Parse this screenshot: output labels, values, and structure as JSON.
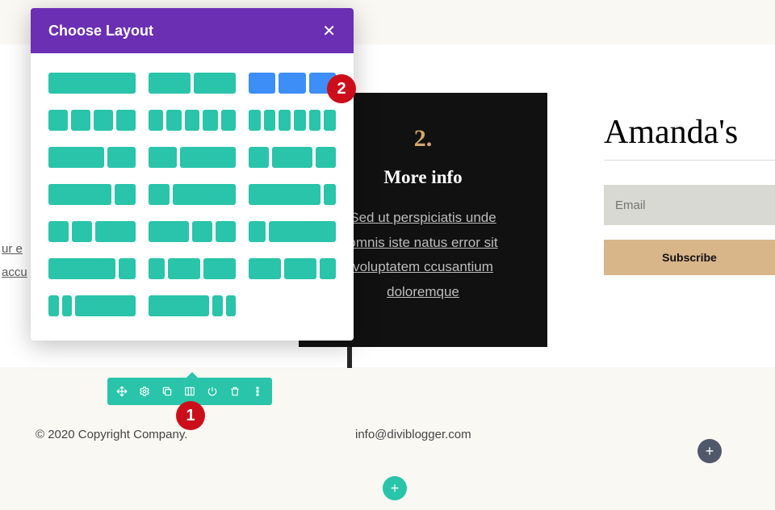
{
  "modal": {
    "title": "Choose Layout",
    "close_glyph": "✕"
  },
  "card": {
    "number": "2.",
    "title": "More info",
    "body": "Sed ut perspiciatis unde omnis iste natus error sit voluptatem ccusantium doloremque"
  },
  "side": {
    "heading": "Amanda's",
    "email_placeholder": "Email",
    "subscribe_label": "Subscribe"
  },
  "left_text": "ur e accu",
  "annotations": {
    "badge1": "1",
    "badge2": "2"
  },
  "footer": {
    "copyright": "© 2020 Copyright Company.",
    "email": "info@diviblogger.com"
  },
  "fab": {
    "plus": "+"
  },
  "colors": {
    "purple": "#6b2fb3",
    "teal": "#29c4a9",
    "blue": "#3d8ef7",
    "red": "#cc0e1b",
    "tan": "#d9b58a",
    "gold": "#d3a76a"
  }
}
